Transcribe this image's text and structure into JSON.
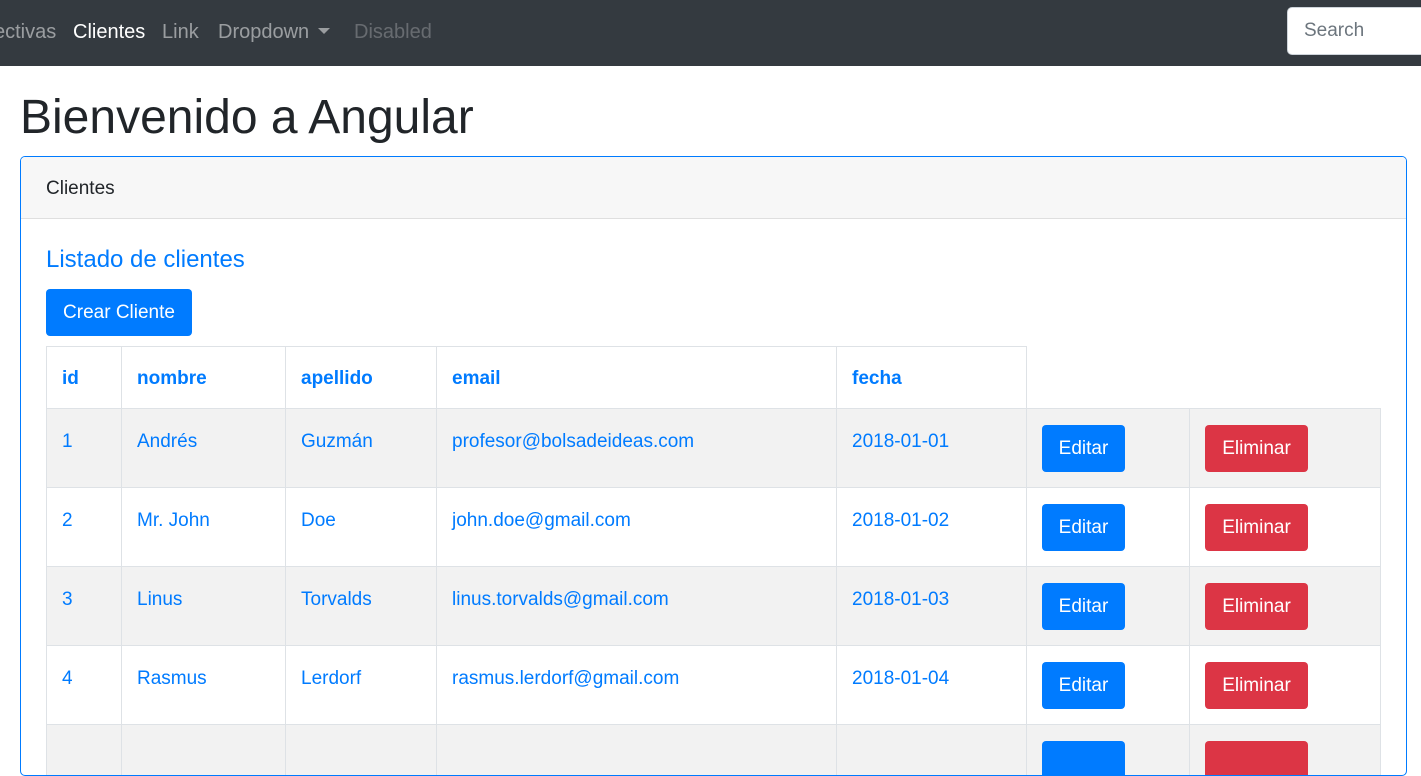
{
  "navbar": {
    "items": [
      {
        "label": "ectivas",
        "state": "inactive"
      },
      {
        "label": "Clientes",
        "state": "active"
      },
      {
        "label": "Link",
        "state": "inactive"
      },
      {
        "label": "Dropdown",
        "state": "inactive"
      },
      {
        "label": "Disabled",
        "state": "disabled"
      }
    ],
    "search_placeholder": "Search"
  },
  "page": {
    "title": "Bienvenido a Angular"
  },
  "card": {
    "header": "Clientes",
    "title": "Listado de clientes",
    "create_button": "Crear Cliente"
  },
  "table": {
    "columns": [
      "id",
      "nombre",
      "apellido",
      "email",
      "fecha"
    ],
    "edit_label": "Editar",
    "delete_label": "Eliminar",
    "rows": [
      {
        "id": "1",
        "nombre": "Andrés",
        "apellido": "Guzmán",
        "email": "profesor@bolsadeideas.com",
        "fecha": "2018-01-01"
      },
      {
        "id": "2",
        "nombre": "Mr. John",
        "apellido": "Doe",
        "email": "john.doe@gmail.com",
        "fecha": "2018-01-02"
      },
      {
        "id": "3",
        "nombre": "Linus",
        "apellido": "Torvalds",
        "email": "linus.torvalds@gmail.com",
        "fecha": "2018-01-03"
      },
      {
        "id": "4",
        "nombre": "Rasmus",
        "apellido": "Lerdorf",
        "email": "rasmus.lerdorf@gmail.com",
        "fecha": "2018-01-04"
      }
    ]
  },
  "colors": {
    "navbar_bg": "#343a40",
    "primary": "#007bff",
    "danger": "#dc3545",
    "stripe": "#f2f2f2"
  }
}
